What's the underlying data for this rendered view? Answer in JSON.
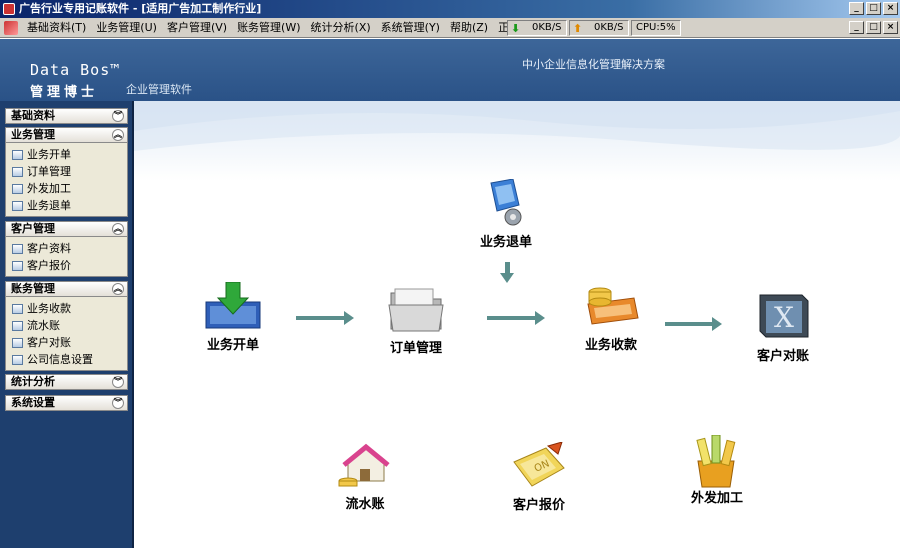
{
  "window": {
    "title": "广告行业专用记账软件 - [适用广告加工制作行业]",
    "min": "_",
    "max": "□",
    "close": "×"
  },
  "menu": {
    "items": [
      {
        "label": "基础资料(T)"
      },
      {
        "label": "业务管理(U)"
      },
      {
        "label": "客户管理(V)"
      },
      {
        "label": "账务管理(W)"
      },
      {
        "label": "统计分析(X)"
      },
      {
        "label": "系统管理(Y)"
      },
      {
        "label": "帮助(Z)"
      },
      {
        "label": "正版软件购"
      }
    ],
    "download_speed": "0KB/S",
    "upload_speed": "0KB/S",
    "cpu": "CPU:5%"
  },
  "header": {
    "brand_en": "Data Bos™",
    "brand_cn": "管理博士",
    "brand_sub": "企业管理软件",
    "slogan": "中小企业信息化管理解决方案"
  },
  "sidebar": {
    "groups": [
      {
        "title": "基础资料",
        "items": []
      },
      {
        "title": "业务管理",
        "items": [
          "业务开单",
          "订单管理",
          "外发加工",
          "业务退单"
        ]
      },
      {
        "title": "客户管理",
        "items": [
          "客户资料",
          "客户报价"
        ]
      },
      {
        "title": "账务管理",
        "items": [
          "业务收款",
          "流水账",
          "客户对账",
          "公司信息设置"
        ]
      },
      {
        "title": "统计分析",
        "items": []
      },
      {
        "title": "系统设置",
        "items": []
      }
    ]
  },
  "flow": {
    "business_order": "业务开单",
    "order_manage": "订单管理",
    "business_return": "业务退单",
    "business_collect": "业务收款",
    "customer_reconcile": "客户对账",
    "cash_journal": "流水账",
    "customer_quote": "客户报价",
    "outsource": "外发加工"
  }
}
